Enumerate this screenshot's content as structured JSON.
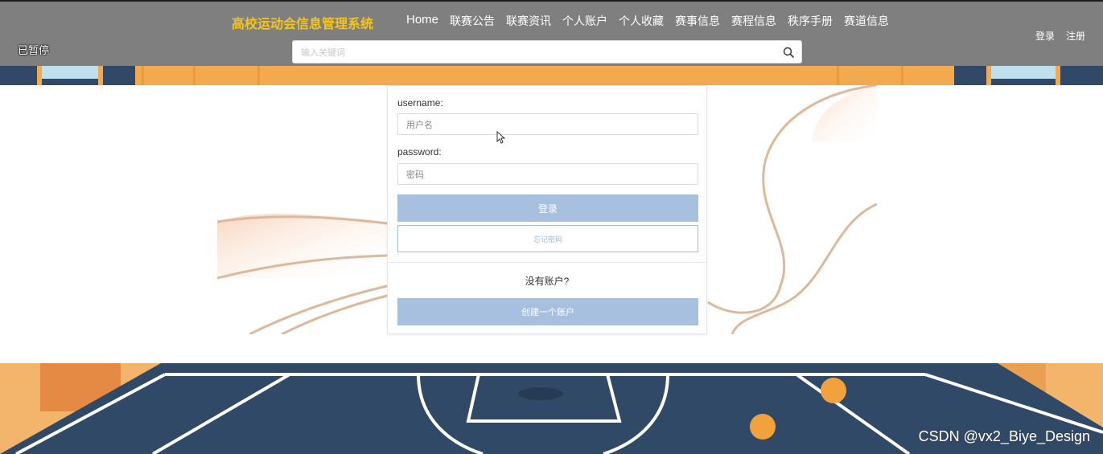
{
  "header": {
    "brand": "高校运动会信息管理系统",
    "paused_label": "已暂停",
    "nav": [
      "Home",
      "联赛公告",
      "联赛资讯",
      "个人账户",
      "个人收藏",
      "赛事信息",
      "赛程信息",
      "秩序手册",
      "赛道信息"
    ],
    "login_label": "登录",
    "register_label": "注册",
    "search": {
      "placeholder": "输入关键词",
      "value": ""
    }
  },
  "login_form": {
    "username_label": "username:",
    "username_placeholder": "用户名",
    "password_label": "password:",
    "password_placeholder": "密码",
    "login_button": "登录",
    "forgot_button": "忘记密码",
    "no_account_text": "没有账户?",
    "create_account_button": "创建一个账户"
  },
  "watermark": "CSDN @vx2_Biye_Design",
  "colors": {
    "brand": "#f5c518",
    "header_bg": "#7f7f7f",
    "button": "#a8c0e0",
    "court": "#2f4966",
    "floor": "#f2b56b"
  }
}
